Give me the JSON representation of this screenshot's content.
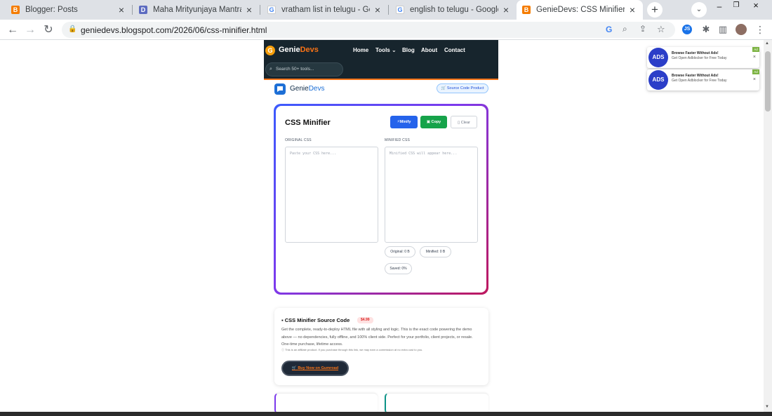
{
  "browser": {
    "tabs": [
      {
        "title": "Blogger: Posts",
        "icon": "blogger-icon",
        "color": "#f57c00",
        "active": false
      },
      {
        "title": "Maha Mrityunjaya Mantra - Dc",
        "icon": "docs-icon",
        "color": "#4285f4",
        "active": false
      },
      {
        "title": "vratham list in telugu - Google",
        "icon": "google-icon",
        "color": "#4285f4",
        "active": false
      },
      {
        "title": "english to telugu - Google Sea",
        "icon": "google-icon",
        "color": "#4285f4",
        "active": false
      },
      {
        "title": "GenieDevs: CSS Minifier",
        "icon": "blogger-icon",
        "color": "#f57c00",
        "active": true
      }
    ],
    "url": "geniedevs.blogspot.com/2026/06/css-minifier.html"
  },
  "site": {
    "header": {
      "logo_letter": "G",
      "brand_a": "Genie",
      "brand_b": "Devs",
      "nav": [
        "Home",
        "Tools ⌄",
        "Blog",
        "About",
        "Contact"
      ],
      "search_placeholder": "Search 50+ tools..."
    },
    "brandbar": {
      "name_a": "Genie",
      "name_b": "Devs",
      "source_button": "Source Code Product"
    },
    "tool": {
      "title": "CSS Minifier",
      "minify_label": "Minify",
      "copy_label": "Copy",
      "clear_label": "Clear",
      "original_label": "ORIGINAL CSS",
      "minified_label": "MINIFIED CSS",
      "original_placeholder": "Paste your CSS here...",
      "minified_placeholder": "Minified CSS will appear here...",
      "stats": [
        "Original: 0 B",
        "Minified: 0 B",
        "Saved: 0%"
      ]
    },
    "product": {
      "title": "CSS Minifier Source Code",
      "price": "$4.99",
      "description": "Get the complete, ready-to-deploy HTML file with all styling and logic. This is the exact code powering the demo above — no dependencies, fully offline, and 100% client side. Perfect for your portfolio, client projects, or resale. One-time purchase, lifetime access.",
      "affiliate_note": "This is an affiliate product. If you purchase through this link, we may earn a commission at no extra cost to you.",
      "buy_label": "Buy Now on Gumroad"
    }
  },
  "ads": [
    {
      "title": "Browse Faster Without Ads!",
      "subtitle": "Get Open Adblocker for Free Today",
      "tag": "Ad"
    },
    {
      "title": "Browse Faster Without Ads!",
      "subtitle": "Get Open Adblocker for Free Today",
      "tag": "Ad"
    }
  ],
  "colors": {
    "accent": "#2563eb",
    "copy": "#16a34a",
    "brand_orange": "#f97316",
    "header_bg": "#17252d"
  }
}
